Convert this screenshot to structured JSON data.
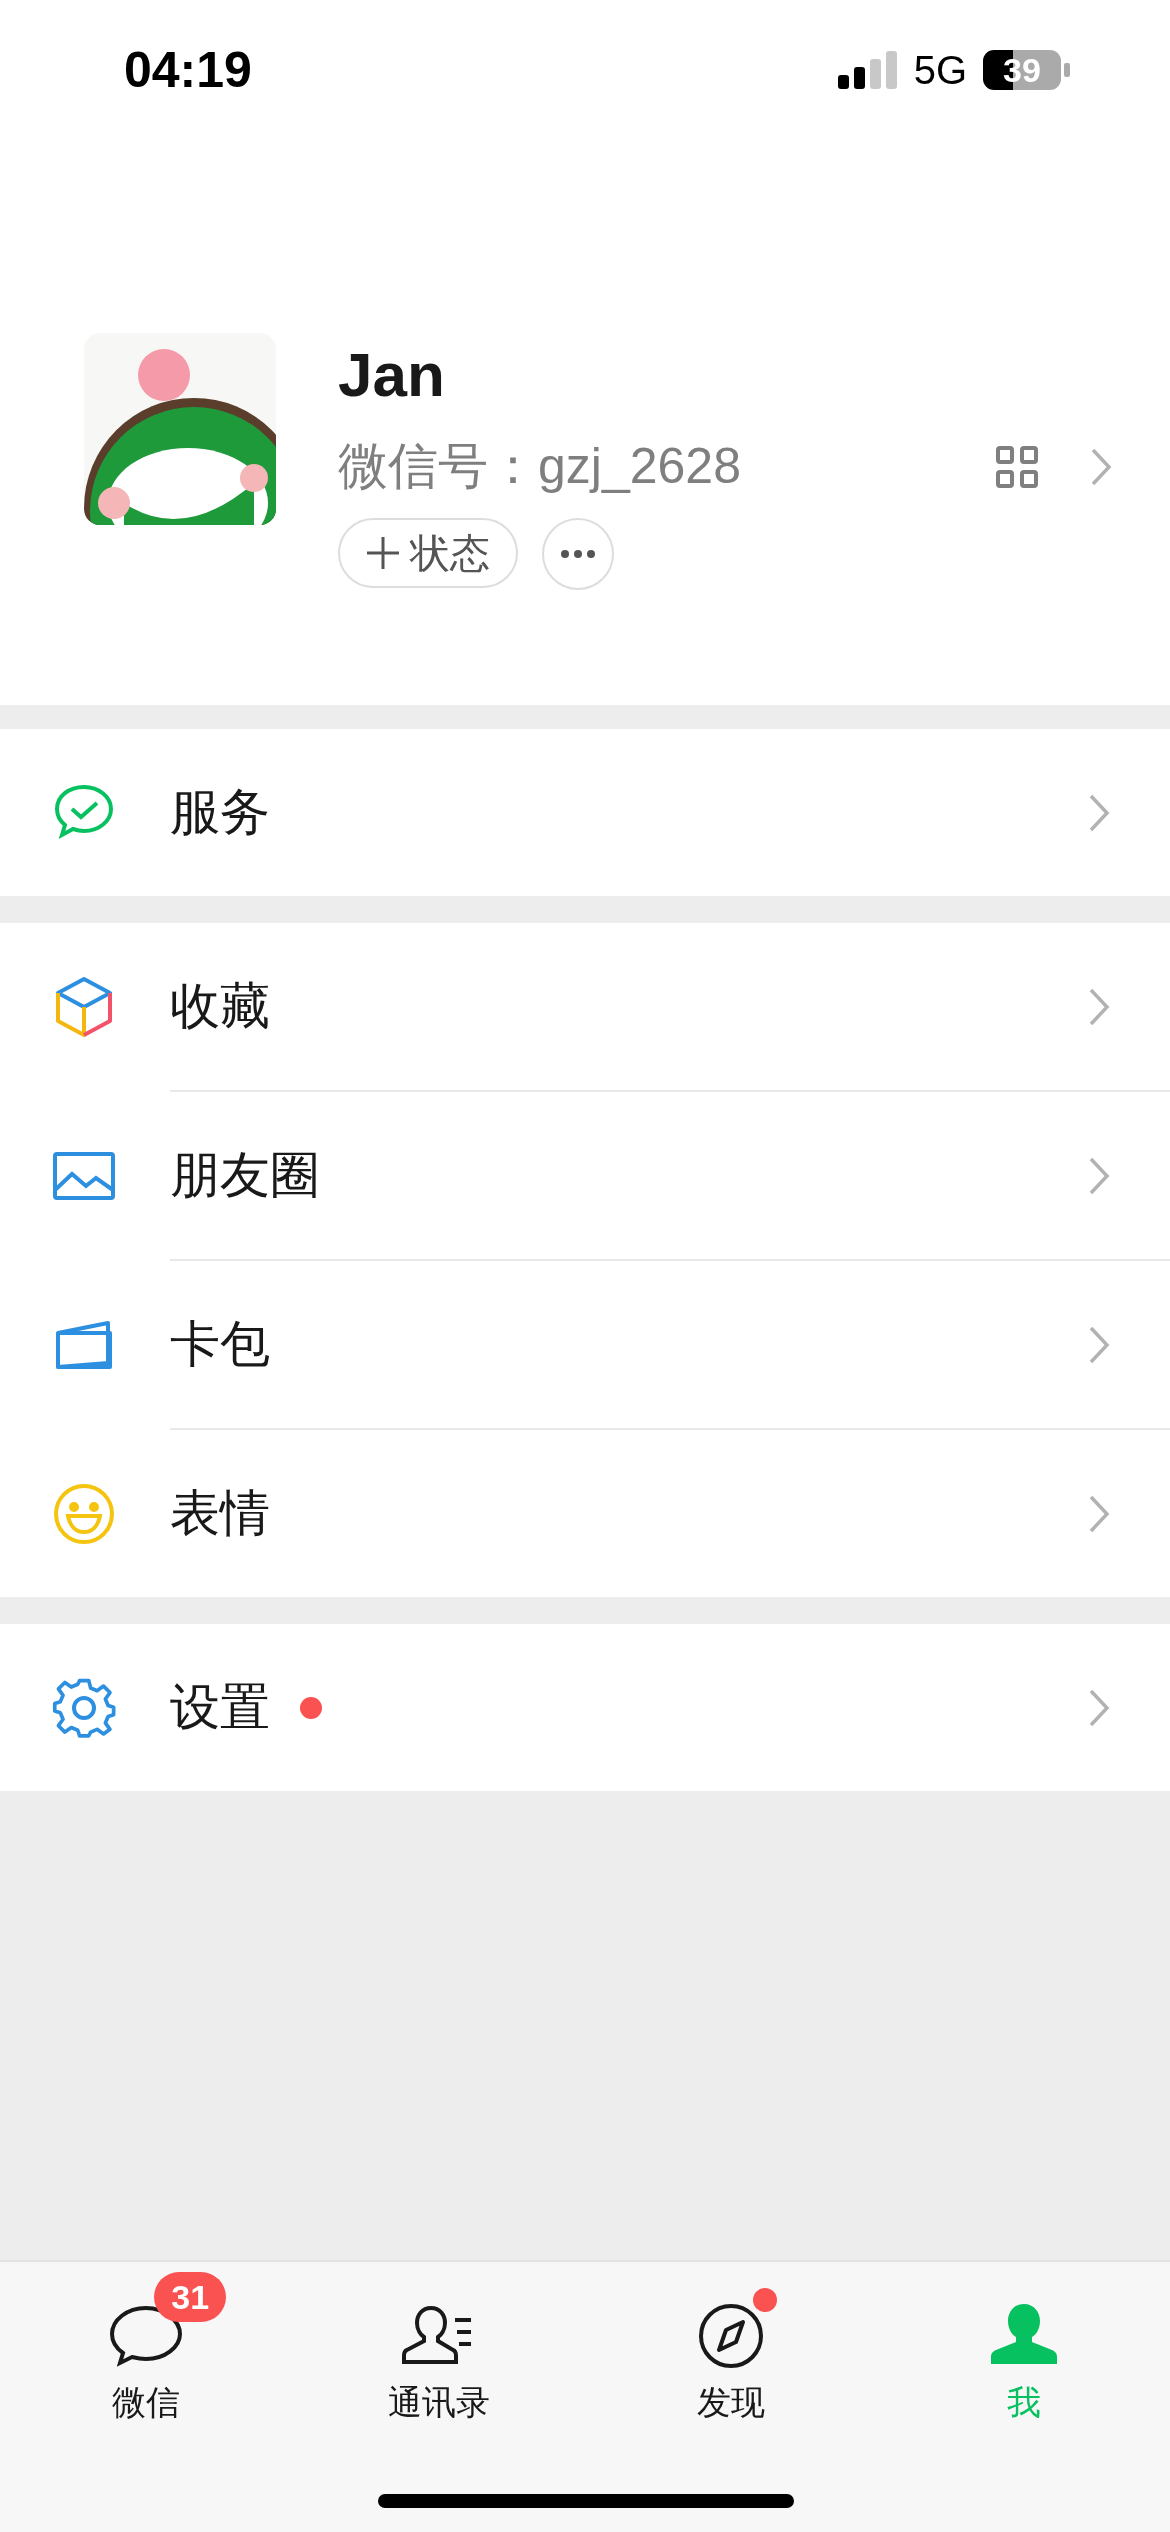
{
  "status_bar": {
    "time": "04:19",
    "network": "5G",
    "battery": "39"
  },
  "profile": {
    "name": "Jan",
    "wechat_id": "微信号：gzj_2628",
    "status_button": "状态"
  },
  "menu_groups": [
    [
      {
        "label": "服务",
        "kind": "service",
        "dot": false
      }
    ],
    [
      {
        "label": "收藏",
        "kind": "favorites",
        "dot": false
      },
      {
        "label": "朋友圈",
        "kind": "moments",
        "dot": false
      },
      {
        "label": "卡包",
        "kind": "cards",
        "dot": false
      },
      {
        "label": "表情",
        "kind": "stickers",
        "dot": false
      }
    ],
    [
      {
        "label": "设置",
        "kind": "settings",
        "dot": true
      }
    ]
  ],
  "tabs": [
    {
      "label": "微信",
      "kind": "chats",
      "badge": "31",
      "dot": false,
      "selected": false
    },
    {
      "label": "通讯录",
      "kind": "contacts",
      "dot": false,
      "selected": false
    },
    {
      "label": "发现",
      "kind": "discover",
      "dot": true,
      "selected": false
    },
    {
      "label": "我",
      "kind": "me",
      "dot": false,
      "selected": true
    }
  ]
}
